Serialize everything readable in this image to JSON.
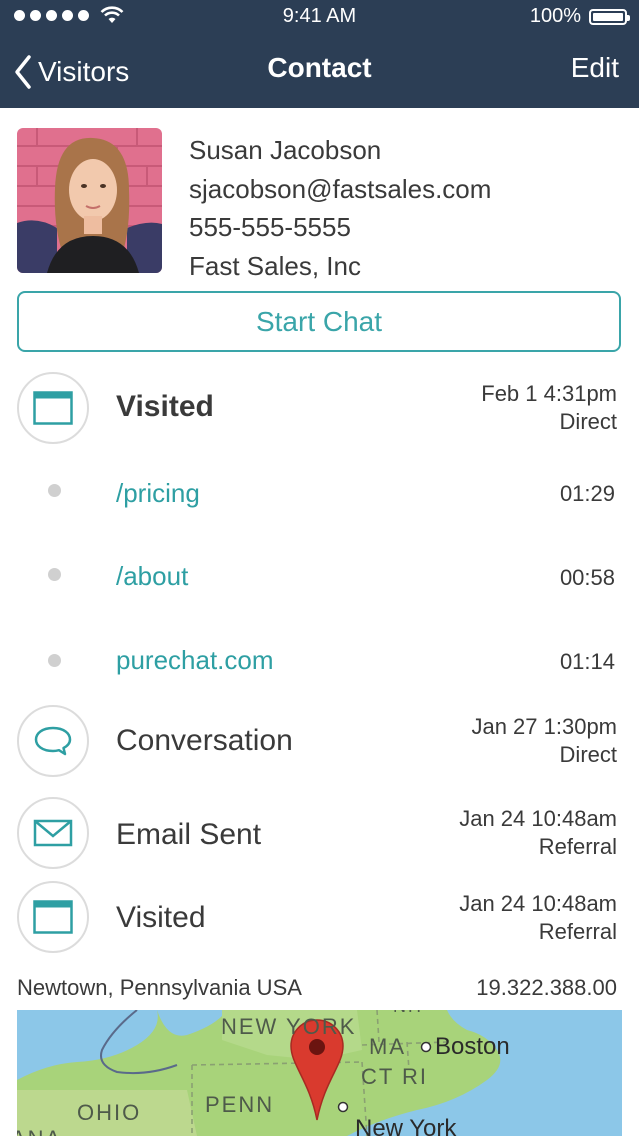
{
  "status_bar": {
    "time": "9:41 AM",
    "battery": "100%"
  },
  "nav": {
    "back_label": "Visitors",
    "title": "Contact",
    "edit_label": "Edit"
  },
  "contact": {
    "name": "Susan Jacobson",
    "email": "sjacobson@fastsales.com",
    "phone": "555-555-5555",
    "company": "Fast Sales, Inc"
  },
  "start_chat_label": "Start Chat",
  "activities": [
    {
      "title": "Visited",
      "date": "Feb 1 4:31pm",
      "source": "Direct",
      "icon": "browser-window-icon"
    },
    {
      "title": "Conversation",
      "date": "Jan 27 1:30pm",
      "source": "Direct",
      "icon": "chat-bubble-icon"
    },
    {
      "title": "Email Sent",
      "date": "Jan 24 10:48am",
      "source": "Referral",
      "icon": "envelope-icon"
    },
    {
      "title": "Visited",
      "date": "Jan 24 10:48am",
      "source": "Referral",
      "icon": "browser-window-icon"
    }
  ],
  "pages": [
    {
      "path": "/pricing",
      "duration": "01:29"
    },
    {
      "path": "/about",
      "duration": "00:58"
    },
    {
      "path": "purechat.com",
      "duration": "01:14"
    }
  ],
  "location": {
    "place": "Newtown, Pennsylvania USA",
    "ip": "19.322.388.00"
  },
  "map": {
    "labels": {
      "ny_state": "NEW YORK",
      "ma": "MA",
      "ct_ri": "CT RI",
      "ohio": "OHIO",
      "penn": "PENN",
      "partial_left": "ANA",
      "partial_top": "NH"
    },
    "cities": {
      "boston": "Boston",
      "new_york": "New York"
    }
  },
  "colors": {
    "nav_bg": "#2c3e55",
    "accent": "#3aa5a9",
    "map_land": "#a8d37a",
    "map_water": "#8cc7e8",
    "pin": "#d93a2e"
  }
}
